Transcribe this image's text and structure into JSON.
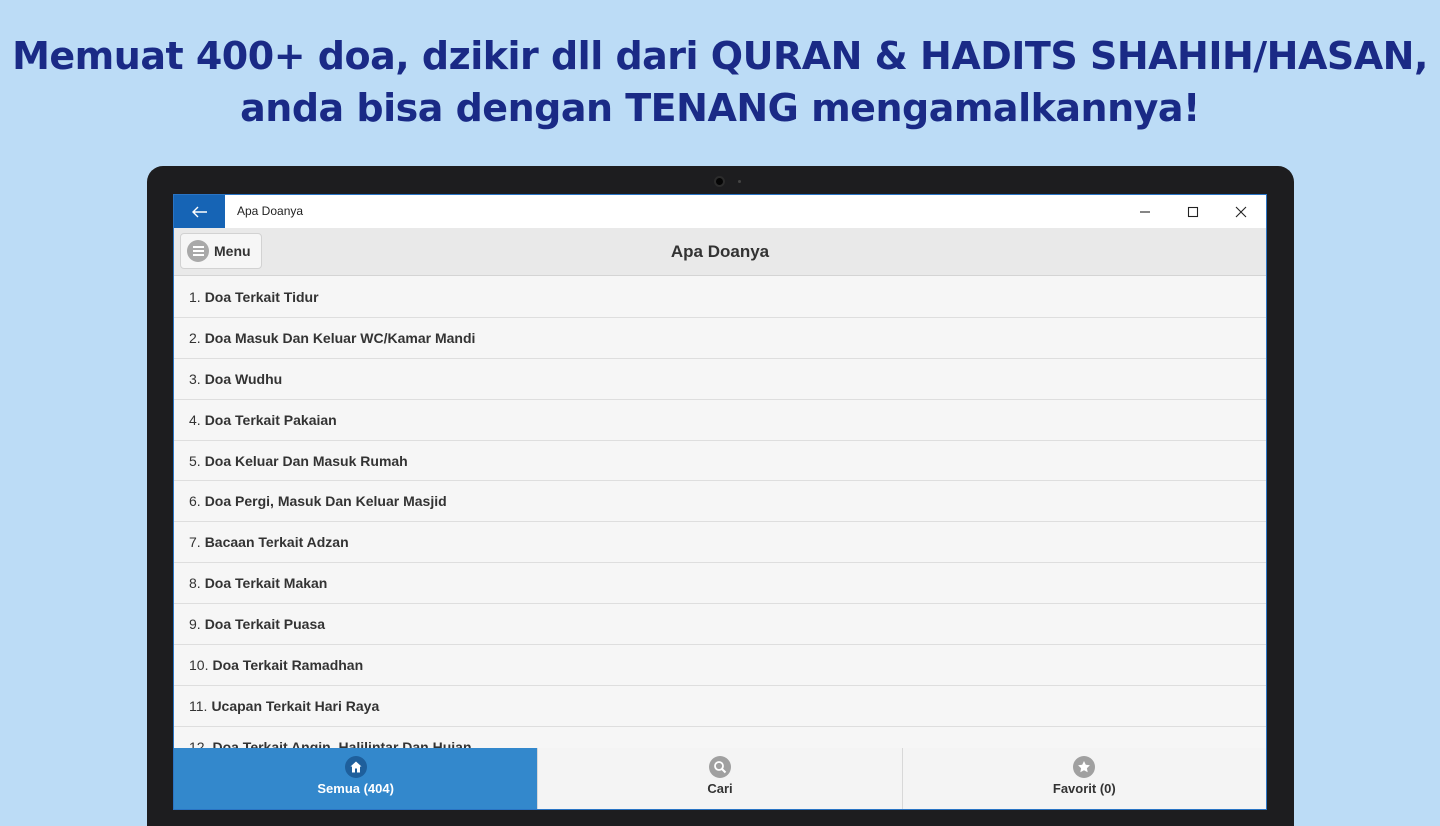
{
  "headline": {
    "line1": "Memuat 400+ doa, dzikir dll dari QURAN & HADITS SHAHIH/HASAN,",
    "line2": "anda bisa dengan TENANG mengamalkannya!"
  },
  "window": {
    "title": "Apa Doanya"
  },
  "appbar": {
    "menu_label": "Menu",
    "title": "Apa Doanya"
  },
  "list": [
    {
      "num": "1.",
      "label": "Doa Terkait Tidur"
    },
    {
      "num": "2.",
      "label": "Doa Masuk Dan Keluar WC/Kamar Mandi"
    },
    {
      "num": "3.",
      "label": "Doa Wudhu"
    },
    {
      "num": "4.",
      "label": "Doa Terkait Pakaian"
    },
    {
      "num": "5.",
      "label": "Doa Keluar Dan Masuk Rumah"
    },
    {
      "num": "6.",
      "label": "Doa Pergi, Masuk Dan Keluar Masjid"
    },
    {
      "num": "7.",
      "label": "Bacaan Terkait Adzan"
    },
    {
      "num": "8.",
      "label": "Doa Terkait Makan"
    },
    {
      "num": "9.",
      "label": "Doa Terkait Puasa"
    },
    {
      "num": "10.",
      "label": "Doa Terkait Ramadhan"
    },
    {
      "num": "11.",
      "label": "Ucapan Terkait Hari Raya"
    },
    {
      "num": "12.",
      "label": "Doa Terkait Angin, Halilintar Dan Hujan"
    }
  ],
  "navbar": {
    "tabs": [
      {
        "label": "Semua (404)",
        "icon": "home-icon",
        "active": true
      },
      {
        "label": "Cari",
        "icon": "search-icon",
        "active": false
      },
      {
        "label": "Favorit (0)",
        "icon": "star-icon",
        "active": false
      }
    ]
  },
  "colors": {
    "background": "#bcdcf6",
    "headline": "#1a2a86",
    "accent": "#3388cc",
    "titlebar_back": "#1664b5"
  }
}
